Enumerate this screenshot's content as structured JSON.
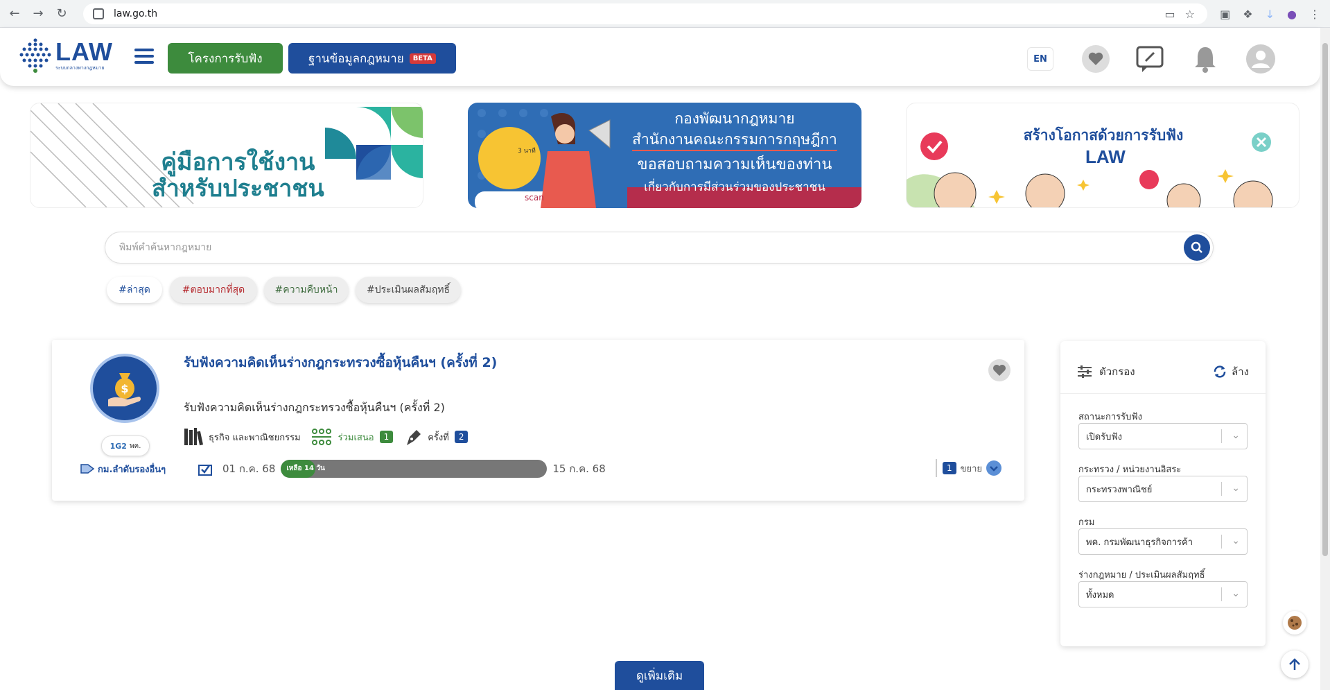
{
  "browser": {
    "url": "law.go.th"
  },
  "header": {
    "logo_text": "LAW",
    "logo_subtitle": "ระบบกลางทางกฎหมาย",
    "btn_hearing": "โครงการรับฟัง",
    "btn_database": "ฐานข้อมูลกฎหมาย",
    "beta": "BETA",
    "lang": "EN"
  },
  "banners": {
    "b1_line1": "คู่มือการใช้งาน",
    "b1_line2": "สำหรับประชาชน",
    "b2_line1": "กองพัฒนากฎหมาย",
    "b2_line2": "สำนักงานคณะกรรมการกฤษฎีกา",
    "b2_line3": "ขอสอบถามความเห็นของท่าน",
    "b2_line4": "เกี่ยวกับการมีส่วนร่วมของประชาชน",
    "b2_badge": "3 นาที",
    "b2_scan": "scan",
    "b3_line1": "สร้างโอกาสด้วยการรับฟัง",
    "b3_logo": "LAW"
  },
  "search": {
    "placeholder": "พิมพ์คำค้นหากฎหมาย"
  },
  "tags": [
    "#ล่าสุด",
    "#ตอบมากที่สุด",
    "#ความคืบหน้า",
    "#ประเมินผลสัมฤทธิ์"
  ],
  "card": {
    "title": "รับฟังความคิดเห็นร่างกฎกระทรวงซื้อหุ้นคืนฯ (ครั้งที่ 2)",
    "description": "รับฟังความคิดเห็นร่างกฎกระทรวงซื้อหุ้นคืนฯ (ครั้งที่ 2)",
    "agency_short": "พค.",
    "category": "ธุรกิจ และพาณิชยกรรม",
    "participate_label": "ร่วมเสนอ",
    "participate_count": "1",
    "round_label": "ครั้งที่",
    "round_count": "2",
    "law_type": "กม.ลำดับรองอื่นๆ",
    "start_date": "01 ก.ค. 68",
    "end_date": "15 ก.ค. 68",
    "remaining": "เหลือ 14 วัน",
    "progress_fraction": 0.13,
    "expand_count": "1",
    "expand_label": "ขยาย"
  },
  "filter": {
    "title": "ตัวกรอง",
    "clear": "ล้าง",
    "status_label": "สถานะการรับฟัง",
    "status_value": "เปิดรับฟัง",
    "ministry_label": "กระทรวง / หน่วยงานอิสระ",
    "ministry_value": "กระทรวงพาณิชย์",
    "dept_label": "กรม",
    "dept_value": "พค. กรมพัฒนาธุรกิจการค้า",
    "type_label": "ร่างกฎหมาย / ประเมินผลสัมฤทธิ์",
    "type_value": "ทั้งหมด"
  },
  "more_button": "ดูเพิ่มเติม",
  "colors": {
    "brand_blue": "#1f4e9c",
    "brand_green": "#3d8b3d",
    "tag_red": "#b5282d",
    "tag_green": "#3d6b3d"
  }
}
